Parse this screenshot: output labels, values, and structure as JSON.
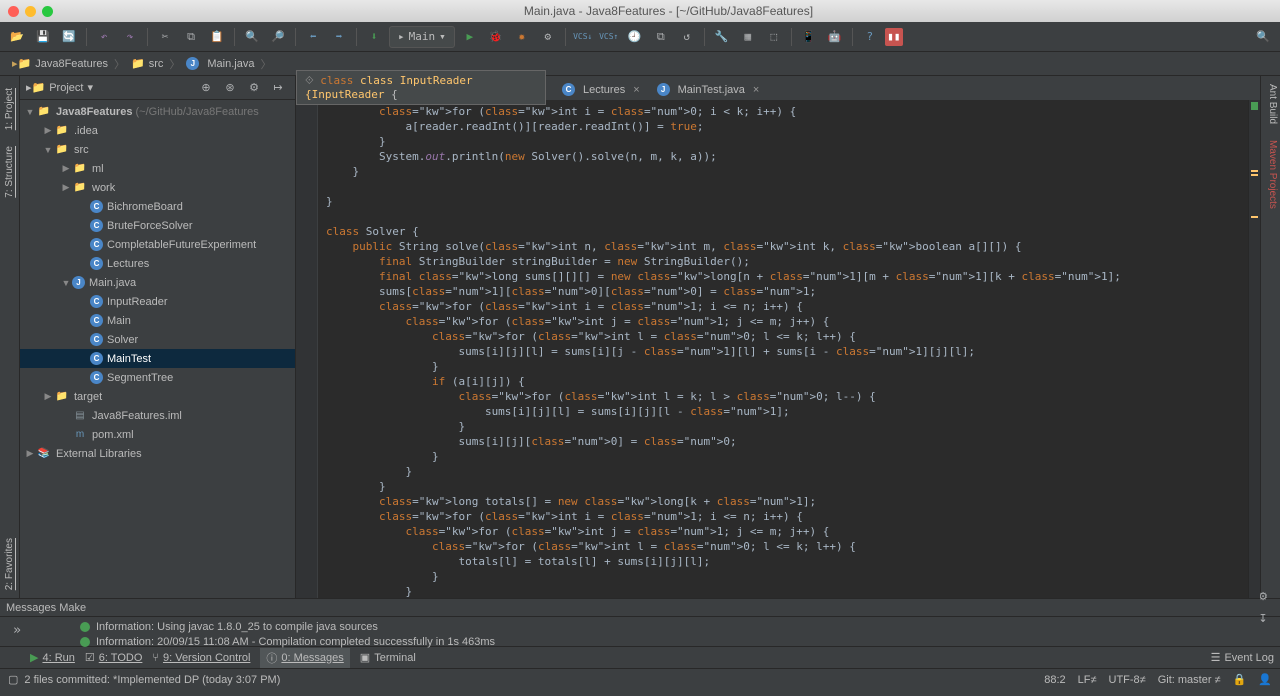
{
  "window": {
    "title": "Main.java - Java8Features - [~/GitHub/Java8Features]"
  },
  "run_config": "Main",
  "breadcrumb": [
    "Java8Features",
    "src",
    "Main.java"
  ],
  "sidebar": {
    "title": "Project",
    "tree": {
      "root": "Java8Features",
      "root_hint": "(~/GitHub/Java8Features",
      "idea": ".idea",
      "src": "src",
      "ml": "ml",
      "work": "work",
      "classes": [
        "BichromeBoard",
        "BruteForceSolver",
        "CompletableFutureExperiment",
        "Lectures"
      ],
      "mainjava": "Main.java",
      "main_children": [
        "InputReader",
        "Main",
        "Solver"
      ],
      "maintest": "MainTest",
      "segtree": "SegmentTree",
      "target": "target",
      "iml": "Java8Features.iml",
      "pom": "pom.xml",
      "external": "External Libraries"
    }
  },
  "floating_nav": "class InputReader {",
  "tabs": {
    "lectures": "Lectures",
    "maintest": "MainTest.java"
  },
  "code_lines": [
    "        for (int i = 0; i < k; i++) {",
    "            a[reader.readInt()][reader.readInt()] = true;",
    "        }",
    "        System.out.println(new Solver().solve(n, m, k, a));",
    "    }",
    "",
    "}",
    "",
    "class Solver {",
    "    public String solve(int n, int m, int k, boolean a[][]) {",
    "        final StringBuilder stringBuilder = new StringBuilder();",
    "        final long sums[][][] = new long[n + 1][m + 1][k + 1];",
    "        sums[1][0][0] = 1;",
    "        for (int i = 1; i <= n; i++) {",
    "            for (int j = 1; j <= m; j++) {",
    "                for (int l = 0; l <= k; l++) {",
    "                    sums[i][j][l] = sums[i][j - 1][l] + sums[i - 1][j][l];",
    "                }",
    "                if (a[i][j]) {",
    "                    for (int l = k; l > 0; l--) {",
    "                        sums[i][j][l] = sums[i][j][l - 1];",
    "                    }",
    "                    sums[i][j][0] = 0;",
    "                }",
    "            }",
    "        }",
    "        long totals[] = new long[k + 1];",
    "        for (int i = 1; i <= n; i++) {",
    "            for (int j = 1; j <= m; j++) {",
    "                for (int l = 0; l <= k; l++) {",
    "                    totals[l] = totals[l] + sums[i][j][l];",
    "                }",
    "            }"
  ],
  "messages": {
    "title": "Messages Make",
    "line1": "Information: Using javac 1.8.0_25 to compile java sources",
    "line2": "Information: 20/09/15 11:08 AM - Compilation completed successfully in 1s 463ms"
  },
  "bottom_tabs": {
    "run": "4: Run",
    "todo": "6: TODO",
    "vcs": "9: Version Control",
    "msg": "0: Messages",
    "term": "Terminal",
    "event_log": "Event Log"
  },
  "left_tabs": {
    "project": "1: Project",
    "structure": "7: Structure",
    "favorites": "2: Favorites"
  },
  "right_tabs": {
    "ant": "Ant Build",
    "maven": "Maven Projects"
  },
  "status": {
    "commit": "2 files committed: *Implemented DP (today 3:07 PM)",
    "pos": "88:2",
    "lf": "LF≠",
    "enc": "UTF-8≠",
    "git": "Git: master ≠"
  }
}
